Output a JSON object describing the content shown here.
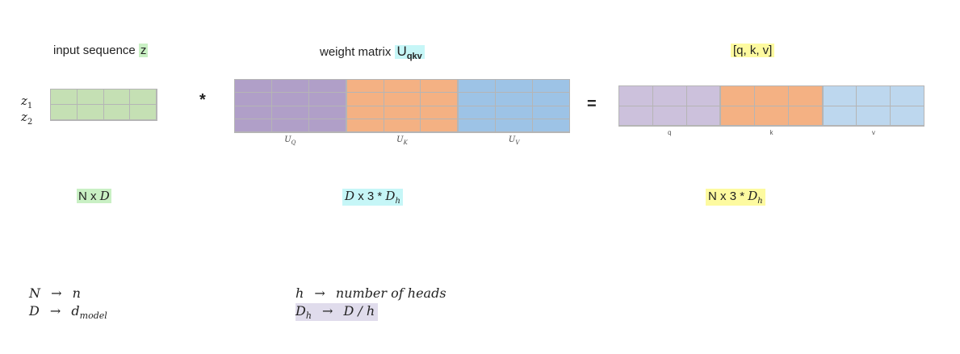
{
  "headers": {
    "input": "input sequence",
    "input_var": "z",
    "weight": "weight matrix",
    "weight_var": "U",
    "weight_sub": "qkv",
    "output": "[q, k, v]"
  },
  "row_labels": [
    {
      "var": "z",
      "sub": "1"
    },
    {
      "var": "z",
      "sub": "2"
    }
  ],
  "operators": {
    "multiply": "*",
    "equals": "="
  },
  "weight_blocks": [
    {
      "var": "U",
      "sub": "Q",
      "color": "#b09fc8"
    },
    {
      "var": "U",
      "sub": "K",
      "color": "#f4b183"
    },
    {
      "var": "U",
      "sub": "V",
      "color": "#9dc3e6"
    }
  ],
  "output_blocks": [
    {
      "label": "q",
      "color": "#ccc1dc"
    },
    {
      "label": "k",
      "color": "#f4b183"
    },
    {
      "label": "v",
      "color": "#bdd7ee"
    }
  ],
  "colors": {
    "input": "#c5e0b4",
    "grid_line": "#b5b5b5"
  },
  "dimensions": {
    "input": {
      "n": "N",
      "x": "x",
      "d": "D"
    },
    "weight": {
      "d": "D",
      "x": "x",
      "three": "3",
      "star": "*",
      "dh": "D",
      "dh_sub": "h"
    },
    "output": {
      "n": "N",
      "x": "x",
      "three": "3",
      "star": "*",
      "dh": "D",
      "dh_sub": "h"
    }
  },
  "legend": [
    {
      "left": "N",
      "arrow": "→",
      "right": "n",
      "right_sub": ""
    },
    {
      "left": "D",
      "arrow": "→",
      "right": "d",
      "right_sub": "model"
    },
    {
      "left": "h",
      "arrow": "→",
      "right": "number of heads",
      "right_sub": ""
    },
    {
      "left": "D",
      "left_sub": "h",
      "arrow": "→",
      "right": "D / h",
      "right_sub": ""
    }
  ]
}
